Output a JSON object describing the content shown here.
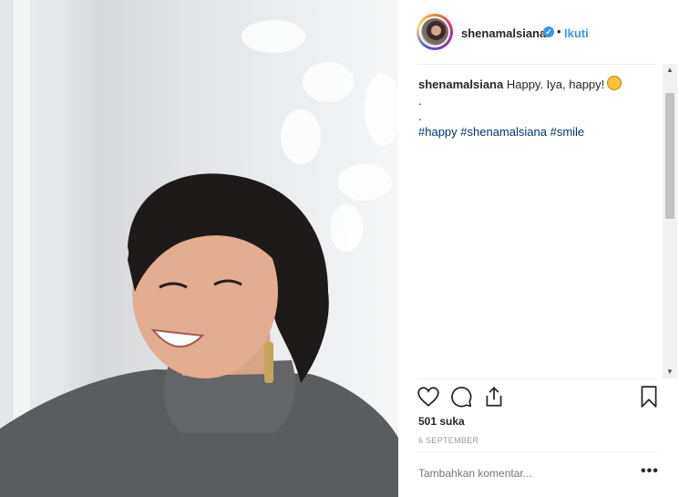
{
  "post": {
    "username": "shenamalsiana",
    "follow_label": "Ikuti",
    "separator": "•",
    "caption_user": "shenamalsiana",
    "caption_text": "Happy. Iya, happy!",
    "caption_lines": [
      ".",
      "."
    ],
    "hashtags": [
      "#happy",
      "#shenamalsiana",
      "#smile"
    ],
    "likes": "501 suka",
    "date": "6 SEPTEMBER",
    "comment_placeholder": "Tambahkan komentar...",
    "more_label": "•••"
  },
  "icons": [
    "heart-icon",
    "comment-icon",
    "share-icon",
    "bookmark-icon",
    "verified-badge-icon",
    "hugging-face-emoji"
  ],
  "colors": {
    "link_blue": "#3897f0",
    "hashtag": "#003569",
    "text": "#262626",
    "muted": "#999999"
  }
}
